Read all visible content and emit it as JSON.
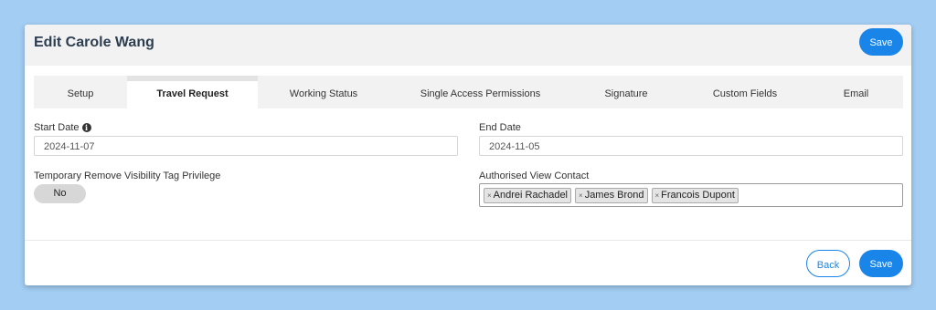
{
  "header": {
    "title": "Edit Carole Wang",
    "save_label": "Save"
  },
  "tabs": [
    {
      "label": "Setup",
      "active": false
    },
    {
      "label": "Travel Request",
      "active": true
    },
    {
      "label": "Working Status",
      "active": false
    },
    {
      "label": "Single Access Permissions",
      "active": false
    },
    {
      "label": "Signature",
      "active": false
    },
    {
      "label": "Custom Fields",
      "active": false
    },
    {
      "label": "Email",
      "active": false
    }
  ],
  "form": {
    "start_date": {
      "label": "Start Date",
      "value": "2024-11-07",
      "icon": "info-icon"
    },
    "end_date": {
      "label": "End Date",
      "value": "2024-11-05"
    },
    "visibility_privilege": {
      "label": "Temporary Remove Visibility Tag Privilege",
      "value": "No"
    },
    "authorised_view_contact": {
      "label": "Authorised View Contact",
      "remove_symbol": "×",
      "tags": [
        "Andrei Rachadel",
        "James Brond",
        "Francois Dupont"
      ]
    }
  },
  "footer": {
    "back_label": "Back",
    "save_label": "Save"
  },
  "colors": {
    "accent": "#1a85e8",
    "background": "#a3cdf3"
  }
}
